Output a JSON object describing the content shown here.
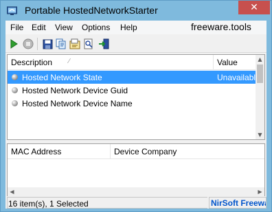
{
  "window": {
    "title": "Portable HostedNetworkStarter",
    "close_glyph": "✕"
  },
  "menu": {
    "items": [
      "File",
      "Edit",
      "View",
      "Options",
      "Help"
    ],
    "brand": "freeware.tools"
  },
  "toolbar": {
    "buttons": [
      "start-icon",
      "stop-icon",
      "save-icon",
      "copy-icon",
      "properties-icon",
      "find-icon",
      "exit-icon"
    ]
  },
  "top_table": {
    "columns": [
      "Description",
      "Value"
    ],
    "rows": [
      {
        "description": "Hosted Network State",
        "value": "Unavailable",
        "selected": true
      },
      {
        "description": "Hosted Network Device Guid",
        "value": "",
        "selected": false
      },
      {
        "description": "Hosted Network Device Name",
        "value": "",
        "selected": false
      }
    ]
  },
  "bottom_table": {
    "columns": [
      "MAC Address",
      "Device Company"
    ]
  },
  "status": {
    "left": "16 item(s), 1 Selected",
    "right": "NirSoft Freeware"
  },
  "colors": {
    "titlebar": "#7fbadd",
    "close_button": "#c7504e",
    "selection": "#3399ff",
    "link": "#0055cc"
  }
}
